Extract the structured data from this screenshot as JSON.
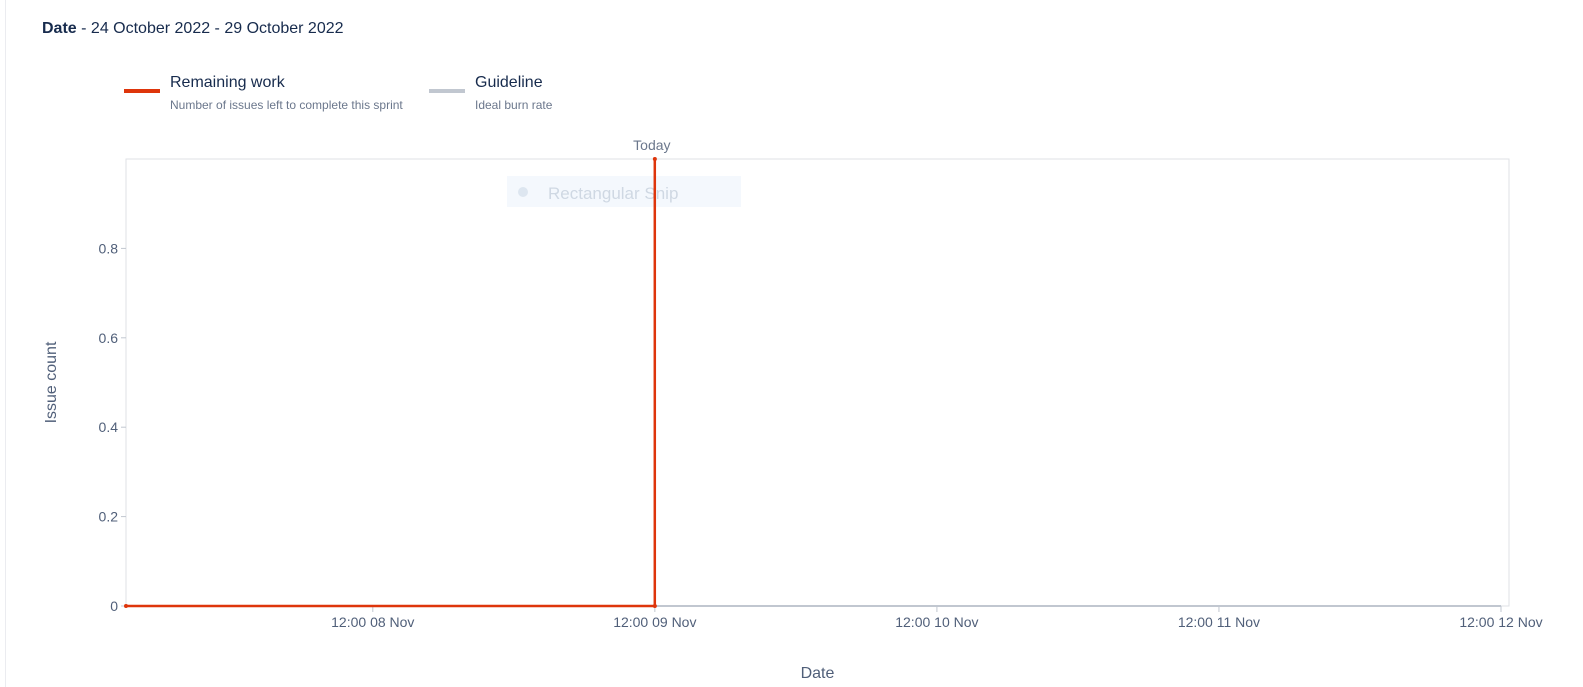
{
  "header": {
    "date_label": "Date",
    "date_range": "- 24 October 2022 - 29 October 2022"
  },
  "legend": [
    {
      "title": "Remaining work",
      "description": "Number of issues left to complete this sprint",
      "color": "#de350b"
    },
    {
      "title": "Guideline",
      "description": "Ideal burn rate",
      "color": "#c1c7d0"
    }
  ],
  "overlay": {
    "text": "Rectangular Snip"
  },
  "chart_data": {
    "type": "line",
    "xlabel": "Date",
    "ylabel": "Issue count",
    "x_tick_labels": [
      "12:00 08 Nov",
      "12:00 09 Nov",
      "12:00 10 Nov",
      "12:00 11 Nov",
      "12:00 12 Nov"
    ],
    "x_ticks": [
      "2022-11-08T12:00",
      "2022-11-09T12:00",
      "2022-11-10T12:00",
      "2022-11-11T12:00",
      "2022-11-12T12:00"
    ],
    "xlim": [
      "2022-11-07T15:00",
      "2022-11-12T12:00"
    ],
    "y_ticks": [
      0,
      0.2,
      0.4,
      0.6,
      0.8
    ],
    "ylim": [
      0,
      1
    ],
    "today_label": "Today",
    "today": "2022-11-09T12:00",
    "series": [
      {
        "name": "Remaining work",
        "color": "#de350b",
        "points": [
          {
            "x": "2022-11-07T15:00",
            "y": 0
          },
          {
            "x": "2022-11-09T12:00",
            "y": 0
          },
          {
            "x": "2022-11-09T12:00",
            "y": 1
          }
        ]
      }
    ],
    "grid": false,
    "legend_position": "top-left"
  }
}
